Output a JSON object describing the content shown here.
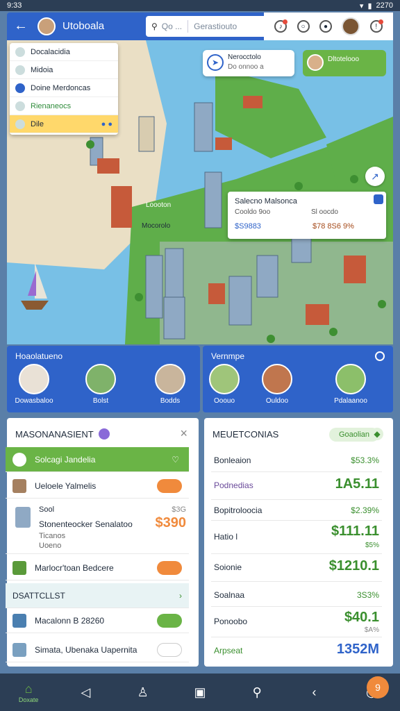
{
  "status_bar": {
    "time": "9:33",
    "right_text": "2270"
  },
  "header": {
    "title": "Utoboala",
    "search_placeholder": "Qo ...",
    "search_value": "Gerastiouto"
  },
  "map": {
    "layers": [
      {
        "label": "Docalacidia"
      },
      {
        "label": "Midoia"
      },
      {
        "label": "Doine Merdoncas"
      },
      {
        "label": "Rienaneocs"
      },
      {
        "label": "Dile"
      }
    ],
    "location_card": {
      "title": "Nerocctolo",
      "subtitle": "Do onnoo a"
    },
    "agent_card": {
      "text": "Dltotelooo"
    },
    "popup": {
      "title": "Salecno Malsonca",
      "subtitle_left": "Cooldo 9oo",
      "subtitle_right": "Sl oocdo",
      "value_left": "$S9883",
      "value_right": "$78 8S6 9%"
    },
    "labels": [
      "Loooton",
      "Mocorolo"
    ]
  },
  "neighborhoods": {
    "left_title": "Hoaolatueno",
    "left_items": [
      {
        "label": "Dowasbaloo"
      },
      {
        "label": "Bolst"
      },
      {
        "label": "Bodds"
      }
    ],
    "right_title": "Vernmpe",
    "right_items": [
      {
        "label": "Ooouo"
      },
      {
        "label": "Ouldoo"
      },
      {
        "label": "Pdalaanoo"
      }
    ]
  },
  "listings": {
    "title": "MASONANASIENT",
    "rows": [
      {
        "label": "Solcagi Jandelia"
      },
      {
        "label": "Ueloele Yalmelis"
      },
      {
        "label": "Stonenteocker Senalatoo",
        "price": "$390",
        "meta_top": "Sool",
        "meta_right": "$3G",
        "meta_a": "Ticanos",
        "meta_b": "Uoeno"
      },
      {
        "label": "Marlocr'toan Bedcere"
      }
    ],
    "section": "DSATTCLLST",
    "bottom_rows": [
      {
        "label": "Macalonn B 28260"
      },
      {
        "label": "Simata, Ubenaka Uapernita"
      }
    ]
  },
  "metrics": {
    "title": "MEUETCONIAS",
    "chip": "Goaolian",
    "rows": [
      {
        "label": "Bonleaion",
        "value": "$53.3%"
      },
      {
        "label": "Podnedias",
        "value": "1A5.11"
      },
      {
        "label": "Bopitroloocia",
        "value": "$2.39%"
      },
      {
        "label": "Hatio l",
        "value": "$111.11",
        "sub": "$5%"
      },
      {
        "label": "Soionie",
        "value": "$1210.1"
      },
      {
        "label": "Soalnaa",
        "value": "3S3%"
      },
      {
        "label": "Ponoobo",
        "value": "$40.1",
        "sub": "$A%"
      },
      {
        "label": "Arpseat",
        "value": "1352M"
      }
    ]
  },
  "bottom_nav": {
    "home_label": "Doxate",
    "fab": "9"
  },
  "colors": {
    "primary": "#2f63c9",
    "accent_green": "#6ab446",
    "accent_orange": "#f08a3c"
  }
}
